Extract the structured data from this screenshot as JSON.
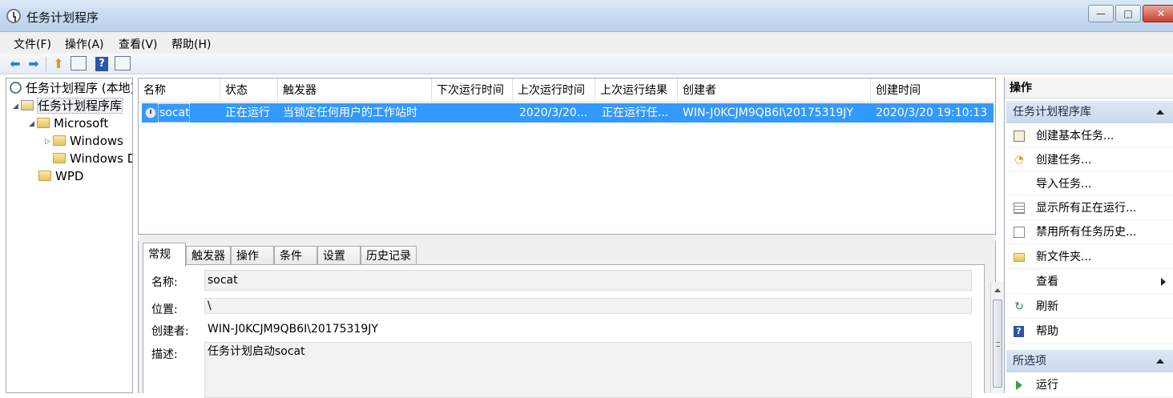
{
  "window": {
    "title": "任务计划程序",
    "min_label": "—",
    "max_label": "□",
    "close_label": "✕"
  },
  "menu": [
    "文件(F)",
    "操作(A)",
    "查看(V)",
    "帮助(H)"
  ],
  "toolbar": {
    "back_icon": "back-arrow-icon",
    "forward_icon": "forward-arrow-icon",
    "up_icon": "up-folder-icon",
    "panel_icon": "show-hide-console-tree-icon",
    "help_label": "?",
    "action_pane_icon": "show-hide-action-pane-icon"
  },
  "tree": {
    "root": "任务计划程序 (本地)",
    "library": "任务计划程序库",
    "microsoft": "Microsoft",
    "windows1": "Windows",
    "windows2": "Windows Defender",
    "wpd": "WPD"
  },
  "tasklist": {
    "columns": [
      "名称",
      "状态",
      "触发器",
      "下次运行时间",
      "上次运行时间",
      "上次运行结果",
      "创建者",
      "创建时间"
    ],
    "rows": [
      {
        "name": "socat",
        "status": "正在运行",
        "trigger": "当锁定任何用户的工作站时",
        "next_run": "",
        "last_run": "2020/3/20...",
        "last_result": "正在运行任...",
        "author": "WIN-J0KCJM9QB6I\\20175319JY",
        "created": "2020/3/20 19:10:13"
      }
    ]
  },
  "detail": {
    "tabs": [
      "常规",
      "触发器",
      "操作",
      "条件",
      "设置",
      "历史记录"
    ],
    "name_label": "名称:",
    "name_value": "socat",
    "location_label": "位置:",
    "location_value": "\\",
    "author_label": "创建者:",
    "author_value": "WIN-J0KCJM9QB6I\\20175319JY",
    "desc_label": "描述:",
    "desc_value": "任务计划启动socat"
  },
  "actions": {
    "title": "操作",
    "section1": "任务计划程序库",
    "items": [
      "创建基本任务...",
      "创建任务...",
      "导入任务...",
      "显示所有正在运行...",
      "禁用所有任务历史...",
      "新文件夹...",
      "查看",
      "刷新",
      "帮助"
    ],
    "section2": "所选项",
    "selected_items": [
      "运行"
    ]
  },
  "colors": {
    "selection": "#3399ff",
    "section_header": "#c9d9ec"
  }
}
